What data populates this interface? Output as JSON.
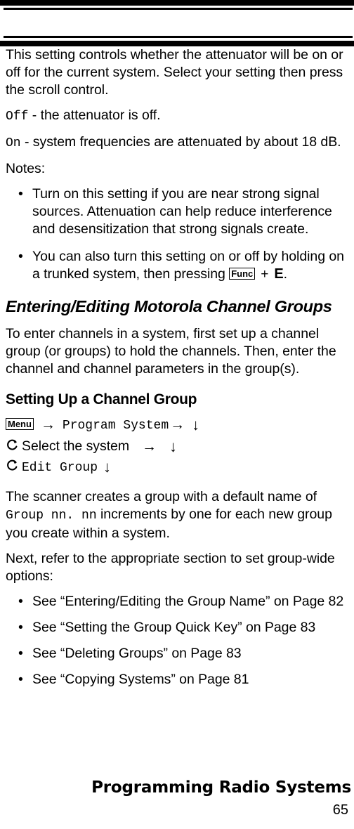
{
  "header": {
    "rules": [
      "thick",
      "thin",
      "thin",
      "thick"
    ]
  },
  "body": {
    "intro_paragraph": "This setting controls whether the attenuator will be on or off for the current system. Select your setting then press the scroll control.",
    "option_off": {
      "value": "Off",
      "description": " - the attenuator is off."
    },
    "option_on": {
      "value": "On",
      "description": " - system frequencies are attenuated by about 18 dB."
    },
    "notes_label": "Notes:",
    "notes": [
      {
        "text": "Turn on this setting if you are near strong signal sources. Attenuation can help reduce interference and desensitization that strong signals create."
      },
      {
        "text_before": "You can also turn this setting on or off by holding on a trunked system, then pressing ",
        "key_label": "Func",
        "plus": "+",
        "second_key": "E",
        "text_after": "."
      }
    ]
  },
  "section": {
    "heading": "Entering/Editing Motorola Channel Groups",
    "paragraph": "To enter channels in a system, first set up a channel group (or groups) to hold the channels. Then, enter the channel and channel parameters in the group(s).",
    "subheading": "Setting Up a Channel Group",
    "nav_steps": [
      {
        "key_label": "Menu",
        "arrow_right_1": "→",
        "menu_item": "Program System",
        "arrow_right_2": "→",
        "arrow_down": "↓"
      },
      {
        "scroll": "scroll-control-icon",
        "label": "Select the system",
        "arrow_right": "→",
        "arrow_down": "↓"
      },
      {
        "scroll": "scroll-control-icon",
        "label": "Edit Group",
        "arrow_down": "↓"
      }
    ],
    "default_name_before": "The scanner creates a group with a default name of ",
    "default_name_mono": "Group nn. nn",
    "default_name_after": " increments by one for each new group you create within a system.",
    "next_paragraph": "Next, refer to the appropriate section to set group-wide options:",
    "references": [
      "See “Entering/Editing the Group Name” on Page 82",
      "See “Setting the Group Quick Key” on Page 83",
      "See “Deleting Groups” on Page 83",
      "See “Copying Systems” on Page 81"
    ],
    "bullet_glyph": "•"
  },
  "footer": {
    "title": "Programming Radio Systems",
    "page_number": "65"
  }
}
